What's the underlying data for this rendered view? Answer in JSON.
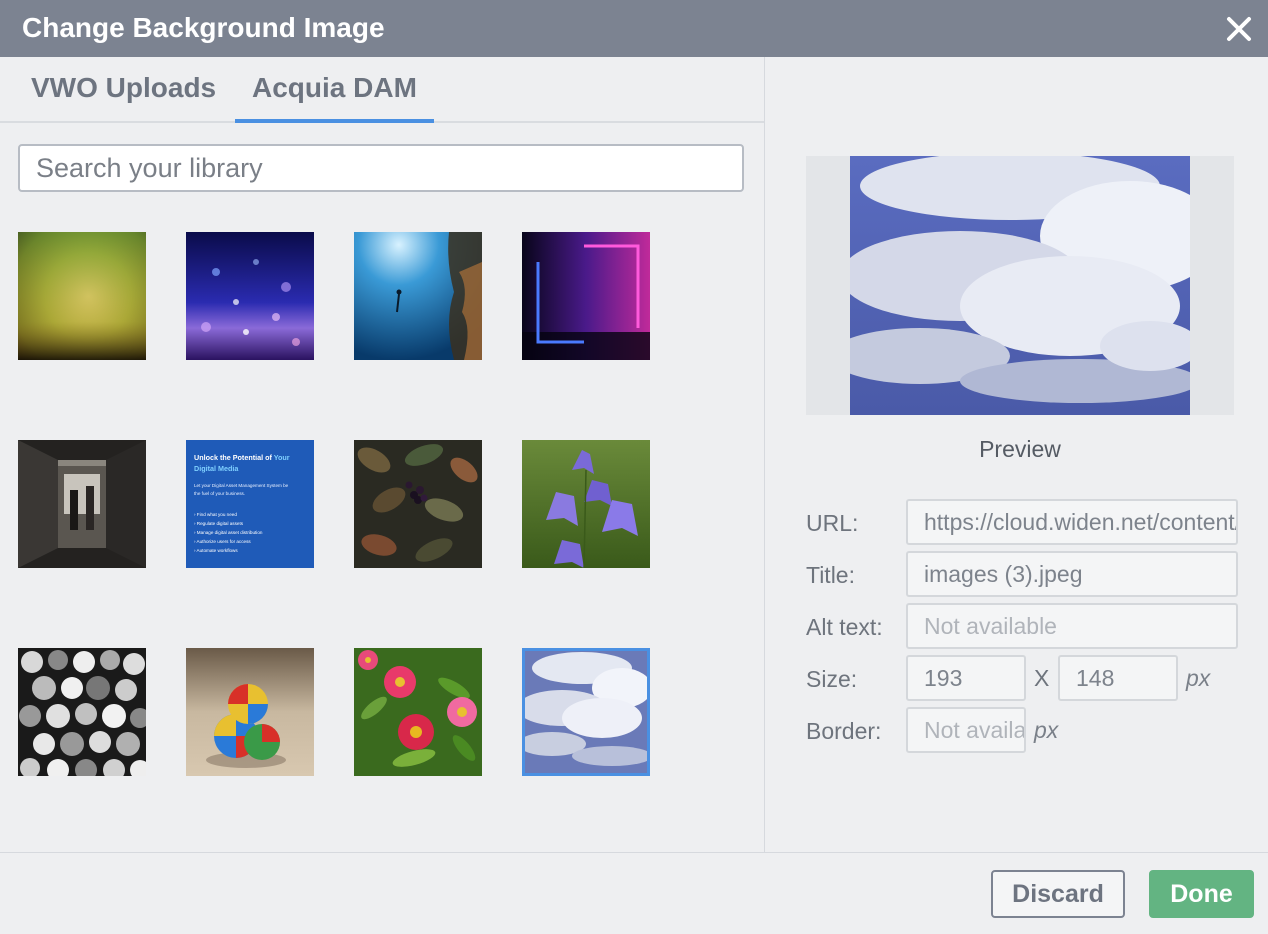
{
  "dialog": {
    "title": "Change Background Image",
    "close_icon": "close-icon"
  },
  "tabs": [
    {
      "label": "VWO Uploads",
      "active": false
    },
    {
      "label": "Acquia DAM",
      "active": true
    }
  ],
  "colors": {
    "titlebar": "#7c8391",
    "accent": "#4a90e2",
    "done": "#63b482"
  },
  "search": {
    "placeholder": "Search your library",
    "value": ""
  },
  "thumbnails": {
    "items": [
      {
        "name": "thumb-green-yellow-gradient"
      },
      {
        "name": "thumb-purple-bokeh"
      },
      {
        "name": "thumb-underwater-diver"
      },
      {
        "name": "thumb-neon-frame"
      },
      {
        "name": "thumb-dark-corridor"
      },
      {
        "name": "thumb-dam-promo",
        "heading1": "Unlock the Potential of ",
        "heading_accent": "Your",
        "heading2": "Digital Media",
        "intro1": "Let your Digital Asset Management System be",
        "intro2": "the fuel of your business.",
        "bullets": [
          "› Find what you need",
          "› Regulate digital assets",
          "› Manage digital asset distribution",
          "› Authorize users for access",
          "› Automate workflows"
        ]
      },
      {
        "name": "thumb-leaves-berries"
      },
      {
        "name": "thumb-purple-bellflowers"
      },
      {
        "name": "thumb-bw-spheres"
      },
      {
        "name": "thumb-juggling-ball"
      },
      {
        "name": "thumb-pink-flowers"
      },
      {
        "name": "thumb-clouds",
        "selected": true
      }
    ]
  },
  "preview": {
    "label": "Preview"
  },
  "details": {
    "url_label": "URL:",
    "url_value": "https://cloud.widen.net/content/",
    "title_label": "Title:",
    "title_value": "images (3).jpeg",
    "alt_label": "Alt text:",
    "alt_placeholder": "Not available",
    "size_label": "Size:",
    "width": "193",
    "size_separator": "X",
    "height": "148",
    "size_unit": "px",
    "border_label": "Border:",
    "border_placeholder": "Not available",
    "border_unit": "px"
  },
  "footer": {
    "discard_label": "Discard",
    "done_label": "Done"
  }
}
